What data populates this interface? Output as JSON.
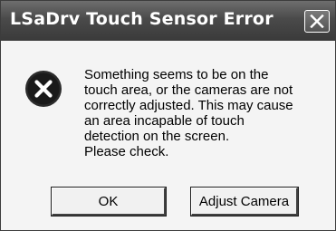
{
  "window": {
    "title": "LSaDrv Touch Sensor Error",
    "close_icon": "close-icon"
  },
  "dialog": {
    "icon": "error-icon",
    "message": "Something seems to be on the\ntouch area, or the cameras are not\ncorrectly adjusted. This may cause\nan area incapable of touch\ndetection on the screen.\nPlease check."
  },
  "buttons": {
    "ok_label": "OK",
    "adjust_label": "Adjust Camera"
  }
}
